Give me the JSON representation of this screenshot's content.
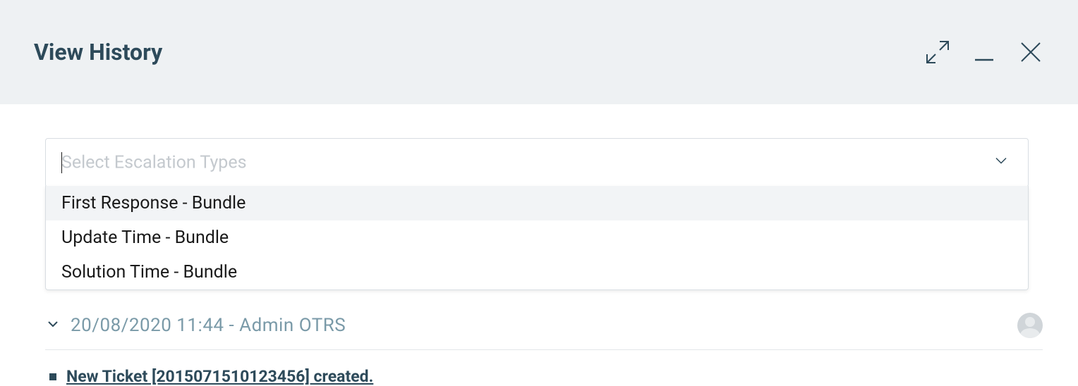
{
  "header": {
    "title": "View History"
  },
  "select": {
    "placeholder": "Select Escalation Types",
    "options": [
      "First Response - Bundle",
      "Update Time - Bundle",
      "Solution Time - Bundle"
    ]
  },
  "history_entry": {
    "timestamp_author": "20/08/2020 11:44 - Admin OTRS"
  },
  "link": {
    "text": "New Ticket [2015071510123456] created."
  }
}
